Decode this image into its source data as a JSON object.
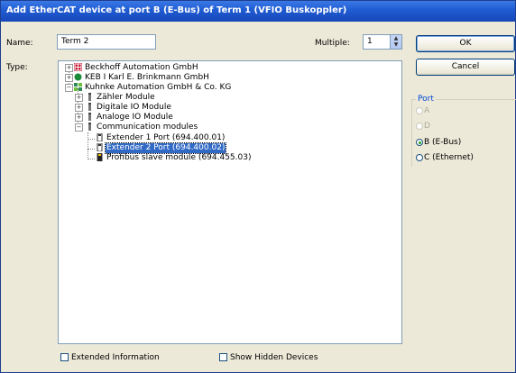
{
  "window": {
    "title": "Add EtherCAT device at port B (E-Bus) of Term 1 (VFIO Buskoppler)"
  },
  "form": {
    "name_label": "Name:",
    "name_value": "Term 2",
    "multiple_label": "Multiple:",
    "multiple_value": "1",
    "type_label": "Type:"
  },
  "buttons": {
    "ok": "OK",
    "cancel": "Cancel"
  },
  "port": {
    "title": "Port",
    "options": [
      {
        "label": "A",
        "enabled": false,
        "selected": false
      },
      {
        "label": "D",
        "enabled": false,
        "selected": false
      },
      {
        "label": "B (E-Bus)",
        "enabled": true,
        "selected": true
      },
      {
        "label": "C (Ethernet)",
        "enabled": true,
        "selected": false
      }
    ]
  },
  "tree": {
    "items": [
      {
        "label": "Beckhoff Automation GmbH",
        "icon": "beckhoff-logo-icon",
        "expander": "+"
      },
      {
        "label": "KEB I Karl E. Brinkmann GmbH",
        "icon": "keb-logo-icon",
        "expander": "+"
      },
      {
        "label": "Kuhnke Automation GmbH & Co. KG",
        "icon": "kuhnke-logo-icon",
        "expander": "-"
      },
      {
        "label": "Zähler Module",
        "icon": "module-icon",
        "expander": "+"
      },
      {
        "label": "Digitale IO Module",
        "icon": "module-icon",
        "expander": "+"
      },
      {
        "label": "Analoge IO Module",
        "icon": "module-icon",
        "expander": "+"
      },
      {
        "label": "Communication modules",
        "icon": "module-icon",
        "expander": "-"
      },
      {
        "label": "Extender 1 Port (694.400.01)",
        "icon": "device-icon",
        "expander": ""
      },
      {
        "label": "Extender 2 Port (694.400.02)",
        "icon": "device-icon",
        "expander": "",
        "selected": true
      },
      {
        "label": "Profibus slave module (694.455.03)",
        "icon": "device-icon",
        "expander": ""
      }
    ]
  },
  "options": {
    "extended_information": "Extended Information",
    "show_hidden_devices": "Show Hidden Devices"
  }
}
